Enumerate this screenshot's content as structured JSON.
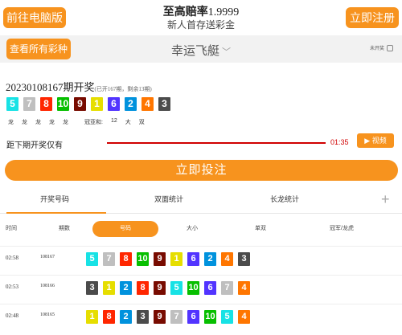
{
  "header": {
    "pc_button": "前往电脑版",
    "title_prefix": "至高赔率",
    "title_rate": "1.9999",
    "subtitle": "新人首存送彩金",
    "register_button": "立即注册"
  },
  "lottery_bar": {
    "all_button": "查看所有彩种",
    "name": "幸运飞艇",
    "menu_label": "未开奖"
  },
  "current": {
    "issue": "20230108167期开奖",
    "issue_note": "(已开167期，剩余13期)",
    "balls": [
      5,
      7,
      8,
      10,
      9,
      1,
      6,
      2,
      4,
      3
    ],
    "stats": [
      "龙",
      "龙",
      "龙",
      "龙",
      "龙",
      "冠亚和:",
      "12",
      "大",
      "双"
    ],
    "countdown_label": "距下期开奖仅有",
    "countdown_time": "01:35",
    "video_button": "视频"
  },
  "bet_button": "立即投注",
  "tabs": {
    "numbers": "开奖号码",
    "double": "双面统计",
    "dragon": "长龙统计"
  },
  "filters": {
    "time": "时间",
    "issue": "期数",
    "numbers": "号码",
    "size": "大小",
    "odd_even": "单双",
    "champion": "冠军/龙虎"
  },
  "history": [
    {
      "time": "02:58",
      "issue": "108167",
      "balls": [
        5,
        7,
        8,
        10,
        9,
        1,
        6,
        2,
        4,
        3
      ]
    },
    {
      "time": "02:53",
      "issue": "108166",
      "balls": [
        3,
        1,
        2,
        8,
        9,
        5,
        10,
        6,
        7,
        4
      ]
    },
    {
      "time": "02:48",
      "issue": "108165",
      "balls": [
        1,
        8,
        2,
        3,
        9,
        7,
        6,
        10,
        5,
        4
      ]
    }
  ],
  "colors": {
    "accent": "#f7931e",
    "countdown_red": "#d00000",
    "ball_1": "#e6de00",
    "ball_2": "#0092dd",
    "ball_3": "#4b4b4b",
    "ball_4": "#ff7600",
    "ball_5": "#17e2e5",
    "ball_6": "#5234ff",
    "ball_7": "#bfbfbf",
    "ball_8": "#ff2600",
    "ball_9": "#780b00",
    "ball_10": "#07bf00"
  }
}
